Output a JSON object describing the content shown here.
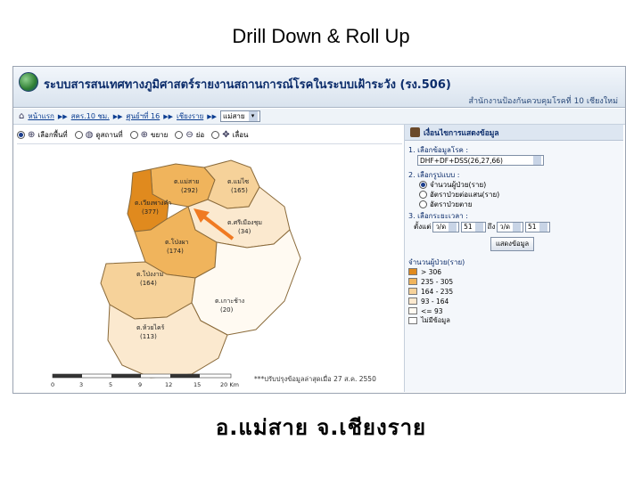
{
  "slide": {
    "title": "Drill Down & Roll Up",
    "caption": "อ.แม่สาย  จ.เชียงราย"
  },
  "app": {
    "system_title": "ระบบสารสนเทศทางภูมิศาสตร์รายงานสถานการณ์โรคในระบบเฝ้าระวัง (รง.506)",
    "subtitle": "สำนักงานป้องกันควบคุมโรคที่ 10 เชียงใหม่",
    "breadcrumb": {
      "items": [
        "หน้าแรก",
        "สคร.10 ชม.",
        "ศูนย์ฯที่ 16",
        "เชียงราย"
      ],
      "select_value": "แม่สาย"
    },
    "toolbar": {
      "items": [
        "เลือกพื้นที่",
        "ดูสถานที่",
        "ขยาย",
        "ย่อ",
        "เลื่อน"
      ]
    },
    "panel": {
      "title": "เงื่อนไขการแสดงข้อมูล",
      "disease_label": "1. เลือกข้อมูลโรค :",
      "disease_value": "DHF+DF+DSS(26,27,66)",
      "format_label": "2. เลือกรูปแบบ :",
      "format_options": [
        "จำนวนผู้ป่วย(ราย)",
        "อัตราป่วยต่อแสน(ราย)",
        "อัตราป่วยตาย"
      ],
      "period_label": "3. เลือกระยะเวลา :",
      "from_label": "ตั้งแต่",
      "to_label": "ถึง",
      "week_placeholder": "ว/ด",
      "year_value": "51",
      "show_button": "แสดงข้อมูล",
      "legend_title": "จำนวนผู้ป่วย(ราย)",
      "legend": [
        {
          "label": "> 306",
          "color": "#e08a1e"
        },
        {
          "label": "235 - 305",
          "color": "#f0b45c"
        },
        {
          "label": "164 - 235",
          "color": "#f6d29a"
        },
        {
          "label": "93 - 164",
          "color": "#fbe9cf"
        },
        {
          "label": "<= 93",
          "color": "#fffaf2"
        },
        {
          "label": "ไม่มีข้อมูล",
          "color": "#ffffff"
        }
      ]
    },
    "map": {
      "regions": [
        {
          "name": "ต.แม่สาย",
          "value": "(292)"
        },
        {
          "name": "ต.เวียงพางคำ",
          "value": "(377)"
        },
        {
          "name": "ต.แม่ไซ",
          "value": "(165)"
        },
        {
          "name": "ต.ศรีเมืองชุม",
          "value": "(34)"
        },
        {
          "name": "ต.โป่งผา",
          "value": "(174)"
        },
        {
          "name": "ต.โป่งงาม",
          "value": "(164)"
        },
        {
          "name": "ต.ห้วยไคร้",
          "value": "(113)"
        },
        {
          "name": "ต.เกาะช้าง",
          "value": "(20)"
        }
      ],
      "scale_ticks": [
        "0",
        "3",
        "5",
        "9",
        "12",
        "15",
        "20 Km"
      ],
      "update_note": "***ปรับปรุงข้อมูลล่าสุดเมื่อ 27 ส.ค. 2550"
    }
  }
}
